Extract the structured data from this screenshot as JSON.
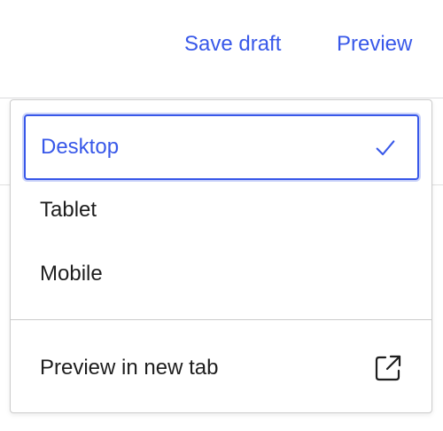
{
  "header": {
    "save_draft_label": "Save draft",
    "preview_label": "Preview"
  },
  "preview_menu": {
    "devices": [
      {
        "label": "Desktop",
        "selected": true
      },
      {
        "label": "Tablet",
        "selected": false
      },
      {
        "label": "Mobile",
        "selected": false
      }
    ],
    "new_tab_label": "Preview in new tab",
    "icons": {
      "selected_check": "check-icon",
      "new_tab": "external-link-icon"
    }
  },
  "colors": {
    "accent": "#3858e9",
    "text": "#1e1e1e",
    "border": "#cccccc"
  }
}
